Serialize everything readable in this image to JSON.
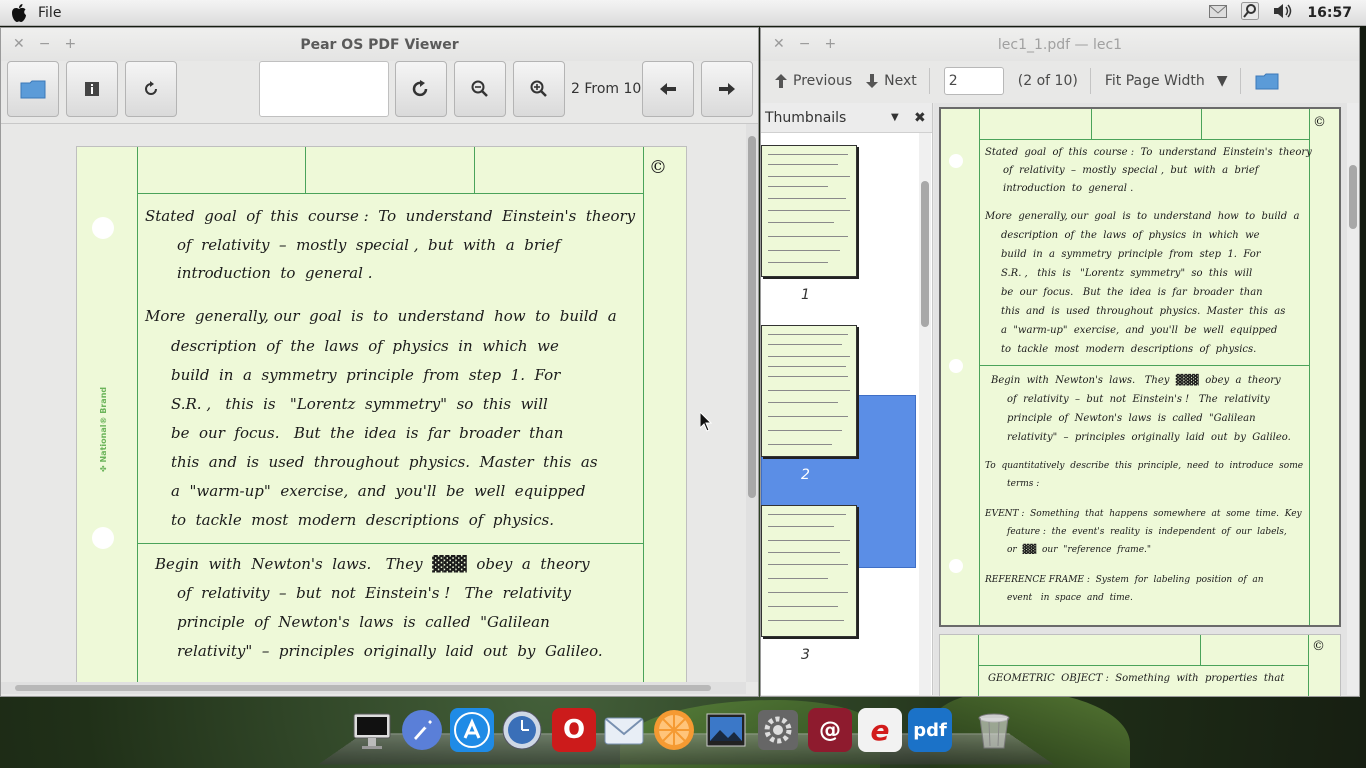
{
  "menubar": {
    "file": "File",
    "clock": "16:57"
  },
  "viewer": {
    "title": "Pear OS PDF Viewer",
    "page_status": "2 From 10"
  },
  "evince": {
    "title": "lec1_1.pdf — lec1",
    "previous": "Previous",
    "next": "Next",
    "page_input": "2",
    "page_of": "(2 of 10)",
    "zoom": "Fit Page Width",
    "thumbnails_label": "Thumbnails",
    "thumbnails": [
      {
        "num": "1"
      },
      {
        "num": "2"
      },
      {
        "num": "3"
      }
    ]
  },
  "page_text": {
    "mark": "©",
    "para1": [
      "Stated  goal  of  this  course :  To  understand  Einstein's  theory",
      "of  relativity  –  mostly  special ,  but  with  a  brief",
      "introduction  to  general ."
    ],
    "para2": [
      "More  generally, our  goal  is  to  understand  how  to  build  a",
      "description  of  the  laws  of  physics  in  which  we",
      "build  in  a  symmetry  principle  from  step  1.  For",
      "S.R. ,   this  is   \"Lorentz  symmetry\"  so  this  will",
      "be  our  focus.   But  the  idea  is  far  broader  than",
      "this  and  is  used  throughout  physics.  Master  this  as",
      "a  \"warm-up\"  exercise,  and  you'll  be  well  equipped",
      "to  tackle  most  modern  descriptions  of  physics."
    ],
    "para3": [
      "Begin  with  Newton's  laws.   They  ▓▓▓  obey  a  theory",
      "of  relativity  –  but  not  Einstein's !   The  relativity",
      "principle  of  Newton's  laws  is  called  \"Galilean",
      "relativity\"  –  principles  originally  laid  out  by  Galileo."
    ],
    "para4": [
      "To  quantitatively  describe  this  principle,  need  to  introduce  some",
      "terms :"
    ],
    "para5": [
      "EVENT :  Something  that  happens  somewhere  at  some  time.  Key",
      "feature :  the  event's  reality  is  independent  of  our  labels,",
      "or  ▓▓  our  \"reference  frame.\""
    ],
    "para6": [
      "REFERENCE FRAME :  System  for  labeling  position  of  an",
      "event   in  space  and  time."
    ],
    "page3_line": "GEOMETRIC  OBJECT :  Something  with  properties  that",
    "brand": "✤ National® Brand"
  },
  "dock": {
    "items": [
      {
        "name": "computer",
        "icon": "monitor-icon"
      },
      {
        "name": "launcher",
        "icon": "rocket-icon"
      },
      {
        "name": "app-store",
        "icon": "appstore-icon"
      },
      {
        "name": "time-machine",
        "icon": "clock-icon"
      },
      {
        "name": "opera",
        "icon": "opera-icon",
        "glyph": "O"
      },
      {
        "name": "mail",
        "icon": "mail-icon"
      },
      {
        "name": "media",
        "icon": "orange-icon"
      },
      {
        "name": "photos",
        "icon": "photo-icon"
      },
      {
        "name": "settings",
        "icon": "gear-icon"
      },
      {
        "name": "email",
        "icon": "at-icon",
        "glyph": "@"
      },
      {
        "name": "reader",
        "icon": "reader-icon",
        "glyph": "e"
      },
      {
        "name": "pdf",
        "icon": "pdf-icon",
        "glyph": "pdf"
      },
      {
        "name": "trash",
        "icon": "trash-icon"
      }
    ]
  },
  "colors": {
    "paper": "#eef9d8",
    "grid": "#4aa35a",
    "selection": "#5b8ee6"
  }
}
